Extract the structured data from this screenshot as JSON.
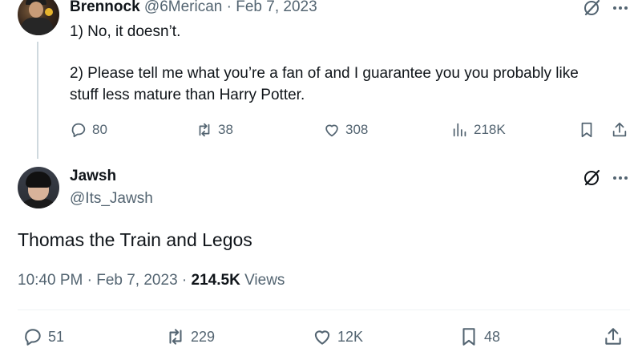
{
  "reply": {
    "author_name": "Brennock",
    "handle": "@6Merican",
    "separator": "·",
    "date": "Feb 7, 2023",
    "text_line1": "1) No, it doesn’t.",
    "text_line2": "2) Please tell me what you’re a fan of and I guarantee you you probably like",
    "text_line3": "stuff less mature than Harry Potter.",
    "replies": "80",
    "retweets": "38",
    "likes": "308",
    "views": "218K"
  },
  "main": {
    "author_name": "Jawsh",
    "handle": "@Its_Jawsh",
    "text": "Thomas the Train and Legos",
    "time": "10:40 PM",
    "separator": "·",
    "date": "Feb 7, 2023",
    "views_count": "214.5K",
    "views_label": "Views",
    "replies": "51",
    "retweets": "229",
    "likes": "12K",
    "bookmarks": "48"
  },
  "colors": {
    "text_primary": "#0f1419",
    "text_secondary": "#536471",
    "thread_line": "#cfd9de",
    "divider": "#eff3f4"
  },
  "icons": [
    "grok-icon",
    "more-icon",
    "reply-icon",
    "retweet-icon",
    "like-icon",
    "views-icon",
    "bookmark-icon",
    "share-icon"
  ]
}
